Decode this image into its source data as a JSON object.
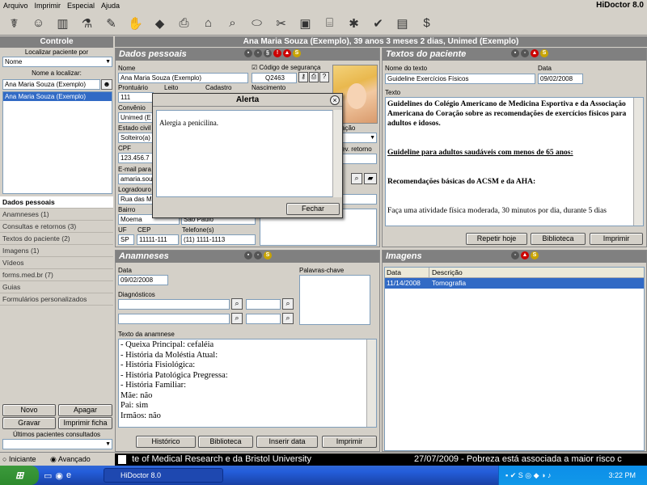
{
  "app": {
    "title": "HiDoctor 8.0"
  },
  "menu": [
    "Arquivo",
    "Imprimir",
    "Especial",
    "Ajuda"
  ],
  "patient_header": "Ana Maria Souza (Exemplo), 39 anos 3 meses 2 dias, Unimed (Exemplo)",
  "left": {
    "title": "Controle",
    "search_by_label": "Localizar paciente por",
    "search_by_value": "Nome",
    "name_label": "Nome a localizar:",
    "name_value": "Ana Maria Souza (Exemplo)",
    "results": [
      "Ana Maria Souza (Exemplo)"
    ],
    "nav": [
      "Dados pessoais",
      "Anamneses  (1)",
      "Consultas e retornos  (3)",
      "Textos do paciente  (2)",
      "Imagens  (1)",
      "Vídeos",
      "forms.med.br  (7)",
      "Guias",
      "Formulários personalizados"
    ],
    "buttons": {
      "new": "Novo",
      "delete": "Apagar",
      "save": "Gravar",
      "print": "Imprimir ficha"
    },
    "recent_label": "Últimos pacientes consultados",
    "mode": {
      "beginner": "Iniciante",
      "advanced": "Avançado"
    }
  },
  "personal": {
    "title": "Dados pessoais",
    "name_label": "Nome",
    "name_value": "Ana Maria Souza (Exemplo)",
    "security_label": "Código de segurança",
    "security_value": "Q2463",
    "prontuario_label": "Prontuário",
    "prontuario_value": "111",
    "leito_label": "Leito",
    "cadastro_label": "Cadastro",
    "nascimento_label": "Nascimento",
    "convenio_label": "Convênio",
    "convenio_value": "Unimed (E",
    "estado_label": "Estado civil",
    "estado_value": "Solteiro(a)",
    "cpf_label": "CPF",
    "cpf_value": "123.456.7",
    "email_label": "E-mail para",
    "email_value": "amaria.sou",
    "logradouro_label": "Logradouro",
    "logradouro_value": "Rua das M",
    "bairro_label": "Bairro",
    "bairro_value": "Moema",
    "cidade_value": "São Paulo",
    "uf_label": "UF",
    "uf_value": "SP",
    "cep_label": "CEP",
    "cep_value": "11111-111",
    "phone_label": "Telefone(s)",
    "phone_value": "(11) 1111-1113",
    "profissao_partial": "ação",
    "retorno_partial": "ev. retorno"
  },
  "alert": {
    "title": "Alerta",
    "message": "Alergia a penicilina.",
    "button": "Fechar"
  },
  "texts": {
    "title": "Textos do paciente",
    "name_label": "Nome do texto",
    "name_value": "Guideline Exercícios Físicos",
    "date_label": "Data",
    "date_value": "09/02/2008",
    "text_label": "Texto",
    "p1": "Guidelines do Colégio Americano de Medicina Esportiva e da Associação Americana do Coração sobre as recomendações de exercícios físicos para adultos e idosos.",
    "p2": "Guideline para adultos saudáveis com menos de 65 anos:",
    "p3": "Recomendações básicas do ACSM e da AHA:",
    "p4": "Faça uma atividade física moderada, 30 minutos por dia, durante 5 dias",
    "buttons": {
      "repeat": "Repetir hoje",
      "library": "Biblioteca",
      "print": "Imprimir"
    }
  },
  "anamneses": {
    "title": "Anamneses",
    "date_label": "Data",
    "date_value": "09/02/2008",
    "keywords_label": "Palavras-chave",
    "diag_label": "Diagnósticos",
    "text_label": "Texto da anamnese",
    "lines": [
      "- Queixa Principal: cefaléia",
      "- História da Moléstia Atual:",
      "- História Fisiológica:",
      "- História Patológica Pregressa:",
      "- História Familiar:",
      "Mãe: não",
      "Pai: sim",
      "Irmãos: não"
    ],
    "buttons": {
      "history": "Histórico",
      "library": "Biblioteca",
      "insert_date": "Inserir data",
      "print": "Imprimir"
    }
  },
  "images": {
    "title": "Imagens",
    "col_date": "Data",
    "col_desc": "Descrição",
    "rows": [
      {
        "date": "11/14/2008",
        "desc": "Tomografia"
      }
    ]
  },
  "ticker": {
    "left": "te of Medical Research e da Bristol University",
    "right": "27/07/2009 - Pobreza está associada a maior risco c"
  },
  "taskbar": {
    "task": "HiDoctor 8.0",
    "time": "3:22 PM"
  },
  "colors": {
    "header": "#808080",
    "selection": "#316ac5",
    "panel": "#d4d0c8"
  }
}
